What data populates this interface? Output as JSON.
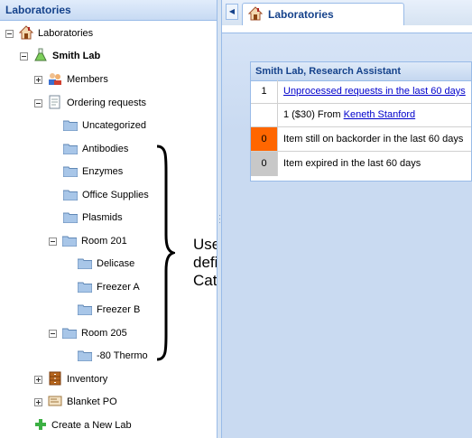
{
  "left_panel": {
    "title": "Laboratories"
  },
  "tree": {
    "root": "Laboratories",
    "lab": "Smith Lab",
    "members": "Members",
    "ordering_requests": "Ordering requests",
    "categories": [
      "Uncategorized",
      "Antibodies",
      "Enzymes",
      "Office Supplies",
      "Plasmids"
    ],
    "room201": "Room 201",
    "room201_children": [
      "Delicase",
      "Freezer A",
      "Freezer B"
    ],
    "room205": "Room 205",
    "room205_children": [
      "-80 Thermo"
    ],
    "inventory": "Inventory",
    "blanket_po": "Blanket PO",
    "create_lab": "Create a New Lab"
  },
  "tab": {
    "label": "Laboratories"
  },
  "panel": {
    "title": "Smith Lab, Research Assistant",
    "rows": [
      {
        "count": "1",
        "text": "Unprocessed requests in the last 60 days"
      },
      {
        "count": "",
        "prefix": "1 ($30) From ",
        "link": "Keneth Stanford"
      },
      {
        "count": "0",
        "text": "Item still on backorder in the last 60 days"
      },
      {
        "count": "0",
        "text": "Item expired in the last 60 days"
      }
    ]
  },
  "annotation": {
    "line1": "User-defined",
    "line2": "Categories"
  },
  "colors": {
    "accent": "#15428b",
    "backorder": "#ff6600",
    "expired": "#c8c8c8",
    "link": "#0000cc"
  }
}
